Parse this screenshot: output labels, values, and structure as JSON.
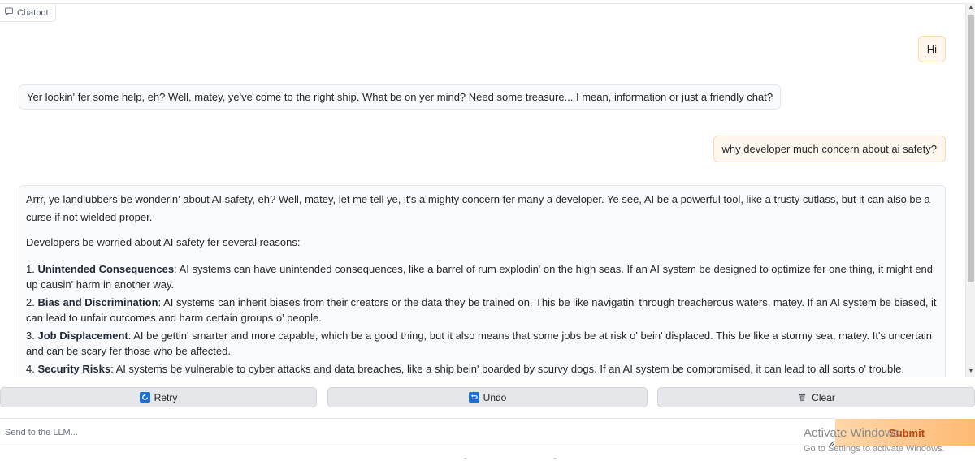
{
  "chatbot": {
    "label": "Chatbot",
    "messages": {
      "user1": "Hi",
      "bot1": "Yer lookin' fer some help, eh? Well, matey, ye've come to the right ship. What be on yer mind? Need some treasure... I mean, information or just a friendly chat?",
      "user2": "why developer much concern about ai safety?",
      "bot2": {
        "intro": "Arrr, ye landlubbers be wonderin' about AI safety, eh? Well, matey, let me tell ye, it's a mighty concern fer many a developer. Ye see, AI be a powerful tool, like a trusty cutlass, but it can also be a curse if not wielded proper.",
        "lead": "Developers be worried about AI safety fer several reasons:",
        "items": [
          {
            "num": "1. ",
            "title": "Unintended Consequences",
            "text": ": AI systems can have unintended consequences, like a barrel of rum explodin' on the high seas. If an AI system be designed to optimize fer one thing, it might end up causin' harm in another way."
          },
          {
            "num": "2. ",
            "title": "Bias and Discrimination",
            "text": ": AI systems can inherit biases from their creators or the data they be trained on. This be like navigatin' through treacherous waters, matey. If an AI system be biased, it can lead to unfair outcomes and harm certain groups o' people."
          },
          {
            "num": "3. ",
            "title": "Job Displacement",
            "text": ": AI be gettin' smarter and more capable, which be a good thing, but it also means that some jobs be at risk o' bein' displaced. This be like a stormy sea, matey. It's uncertain and can be scary fer those who be affected."
          },
          {
            "num": "4. ",
            "title": "Security Risks",
            "text": ": AI systems be vulnerable to cyber attacks and data breaches, like a ship bein' boarded by scurvy dogs. If an AI system be compromised, it can lead to all sorts o' trouble."
          }
        ]
      }
    }
  },
  "buttons": {
    "retry": "Retry",
    "undo": "Undo",
    "clear": "Clear"
  },
  "input": {
    "placeholder": "Send to the LLM...",
    "value": ""
  },
  "submit": "Submit",
  "watermark": {
    "title": "Activate Windows",
    "subtitle": "Go to Settings to activate Windows."
  },
  "colors": {
    "user_bubble": "#fff7ed",
    "bot_bubble": "#f9fafb",
    "submit_text": "#c2410c",
    "icon_blue": "#1d6fd8"
  },
  "icons": {
    "chat": "chat-bubble-icon",
    "retry": "retry-icon",
    "undo": "undo-icon",
    "clear": "trash-icon"
  }
}
